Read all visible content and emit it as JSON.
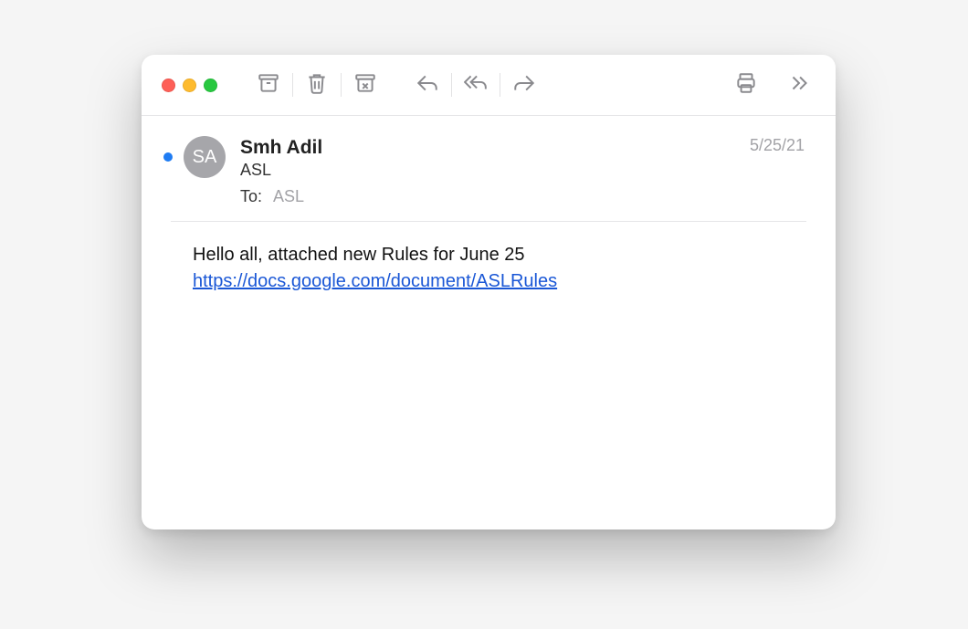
{
  "traffic": {
    "close": "close",
    "min": "minimize",
    "max": "maximize"
  },
  "header": {
    "unread": true,
    "avatar_initials": "SA",
    "from_name": "Smh Adil",
    "subject": "ASL",
    "to_label": "To:",
    "to_value": "ASL",
    "date": "5/25/21"
  },
  "body": {
    "text_line": "Hello all, attached new Rules for June 25",
    "link_text": "https://docs.google.com/document/ASLRules",
    "link_href": "https://docs.google.com/document/ASLRules"
  }
}
